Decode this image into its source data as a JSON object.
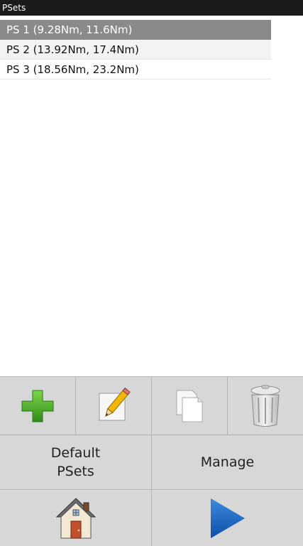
{
  "window": {
    "title": "PSets"
  },
  "psets": [
    {
      "label": "PS 1 (9.28Nm, 11.6Nm)",
      "selected": true
    },
    {
      "label": "PS 2 (13.92Nm, 17.4Nm)",
      "selected": false
    },
    {
      "label": "PS 3 (18.56Nm, 23.2Nm)",
      "selected": false
    }
  ],
  "toolbar": {
    "add_icon": "plus-icon",
    "edit_icon": "pencil-icon",
    "copy_icon": "copy-documents-icon",
    "delete_icon": "trash-can-icon"
  },
  "actions": {
    "default_psets_label": "Default\nPSets",
    "manage_label": "Manage"
  },
  "navigation": {
    "home_icon": "home-icon",
    "play_icon": "play-icon"
  },
  "colors": {
    "titlebar": "#1b1b1b",
    "selected_row": "#8a8a8a",
    "button_bg": "#d7d7d7",
    "plus_green": "#4caf2a",
    "play_blue": "#1565c0"
  }
}
